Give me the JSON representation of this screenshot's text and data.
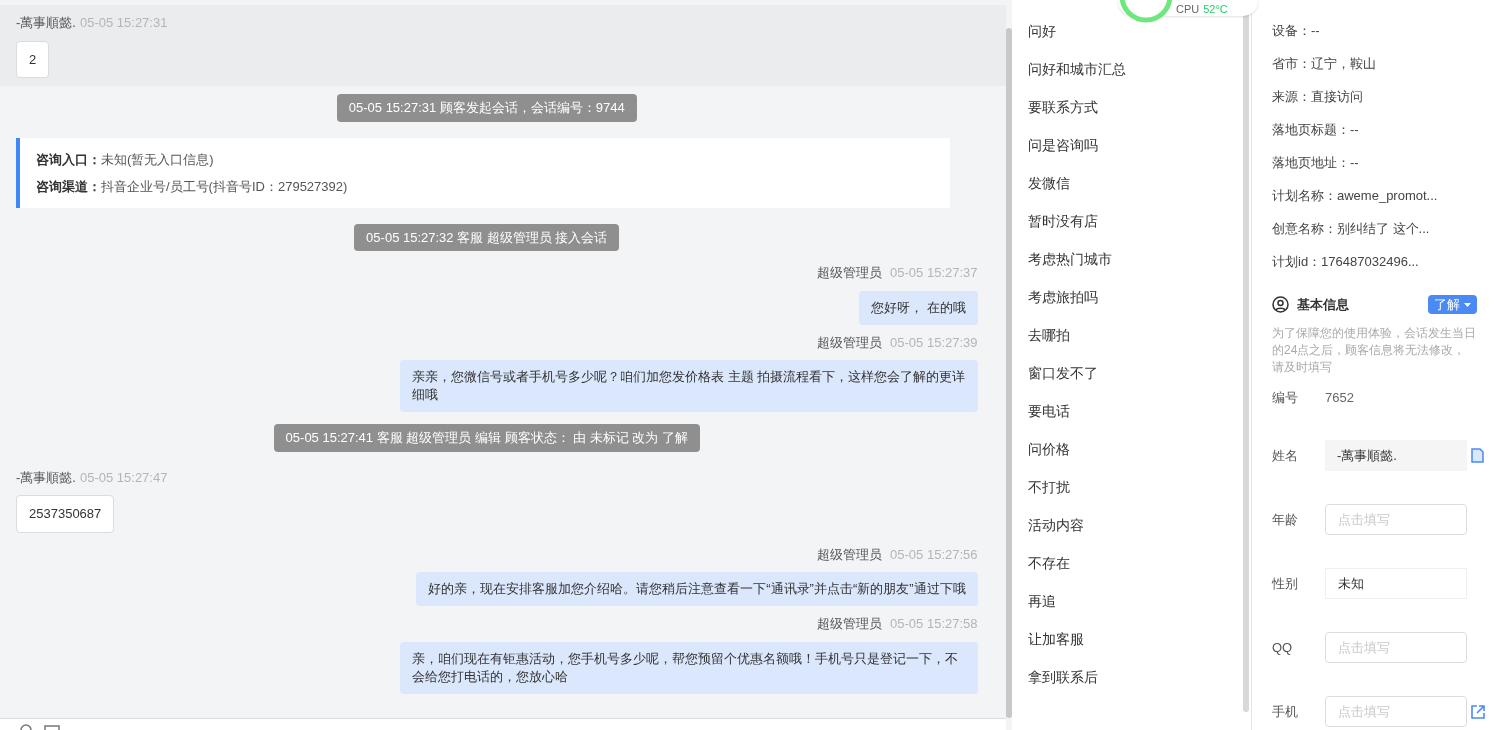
{
  "chat": {
    "messages": [
      {
        "kind": "customer",
        "sender": "-萬事順懿.",
        "time": "05-05 15:27:31",
        "text": "2",
        "highlighted": true
      },
      {
        "kind": "system",
        "text": "05-05 15:27:31 顾客发起会话，会话编号：9744"
      },
      {
        "kind": "info",
        "lines": [
          {
            "label": "咨询入口：",
            "value": "未知(暂无入口信息)"
          },
          {
            "label": "咨询渠道：",
            "value": "抖音企业号/员工号(抖音号ID：279527392)"
          }
        ]
      },
      {
        "kind": "system",
        "text": "05-05 15:27:32 客服 超级管理员 接入会话"
      },
      {
        "kind": "agent",
        "sender": "超级管理员",
        "time": "05-05 15:27:37",
        "text": "您好呀， 在的哦"
      },
      {
        "kind": "agent",
        "sender": "超级管理员",
        "time": "05-05 15:27:39",
        "text": "亲亲，您微信号或者手机号多少呢？咱们加您发价格表 主题 拍摄流程看下，这样您会了解的更详细哦"
      },
      {
        "kind": "system",
        "text": "05-05 15:27:41 客服 超级管理员 编辑 顾客状态： 由 未标记 改为 了解"
      },
      {
        "kind": "customer",
        "sender": "-萬事順懿.",
        "time": "05-05 15:27:47",
        "text": "2537350687",
        "highlighted": false
      },
      {
        "kind": "agent",
        "sender": "超级管理员",
        "time": "05-05 15:27:56",
        "text": "好的亲，现在安排客服加您介绍哈。请您稍后注意查看一下“通讯录”并点击“新的朋友”通过下哦"
      },
      {
        "kind": "agent",
        "sender": "超级管理员",
        "time": "05-05 15:27:58",
        "text": "亲，咱们现在有钜惠活动，您手机号多少呢，帮您预留个优惠名额哦！手机号只是登记一下，不会给您打电话的，您放心哈"
      }
    ]
  },
  "quick_replies": [
    "问好",
    "问好和城市汇总",
    "要联系方式",
    "问是咨询吗",
    "发微信",
    "暂时没有店",
    "考虑热门城市",
    "考虑旅拍吗",
    "去哪拍",
    "窗口发不了",
    "要电话",
    "问价格",
    "不打扰",
    "活动内容",
    "不存在",
    "再追",
    "让加客服",
    "拿到联系后"
  ],
  "cpu_widget": {
    "label": "CPU",
    "value": "52°C"
  },
  "visitor_info": [
    "设备：--",
    "省市：辽宁，鞍山",
    "来源：直接访问",
    "落地页标题：--",
    "落地页地址：--",
    "计划名称：aweme_promot...",
    "创意名称：别纠结了 这个...",
    "计划id：176487032496..."
  ],
  "basic_info": {
    "title": "基本信息",
    "status": "了解",
    "note": "为了保障您的使用体验，会话发生当日的24点之后，顾客信息将无法修改，请及时填写",
    "fields": [
      {
        "kind": "text",
        "label": "编号",
        "value": "7652"
      },
      {
        "kind": "locked",
        "label": "姓名",
        "value": "-萬事順懿.",
        "copy_icon": true
      },
      {
        "kind": "input",
        "label": "年龄",
        "placeholder": "点击填写"
      },
      {
        "kind": "select",
        "label": "性别",
        "value": "未知"
      },
      {
        "kind": "input",
        "label": "QQ",
        "placeholder": "点击填写"
      },
      {
        "kind": "input",
        "label": "手机",
        "placeholder": "点击填写",
        "link_icon": true
      }
    ]
  }
}
